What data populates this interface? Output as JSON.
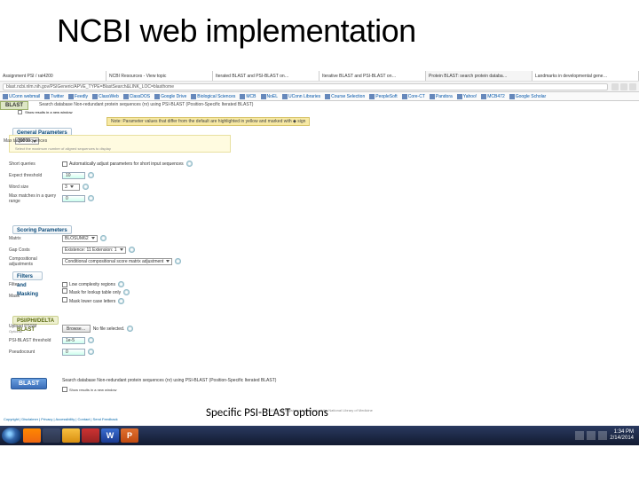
{
  "slide_title": "NCBI web implementation",
  "annotation": "Specific PSI-BLAST options",
  "tabs": [
    {
      "label": "Assignment PSI / rat4200"
    },
    {
      "label": "NCBI Resources - View topic"
    },
    {
      "label": "Iterated BLAST and PSI-BLAST on…"
    },
    {
      "label": "Iterative BLAST and PSI-BLAST on…"
    },
    {
      "label": "Protein BLAST: search protein databa…"
    },
    {
      "label": "Landmarks in developmental gene…"
    }
  ],
  "url": "blast.ncbi.nlm.nih.gov/PSIGeneric/APVE_TYPE=BlastSearch&LINK_LOC=blasthome",
  "bookmarks": [
    "UConn webmail",
    "Twitter",
    "Feedly",
    "ClassWeb",
    "ClassDOS",
    "Google Drive",
    "Biological Sciences",
    "MCB",
    "NoEL",
    "UConn Libraries",
    "Course Selection",
    "PeopleSoft",
    "Core-CT",
    "Pandora",
    "Yahoo!",
    "MCB472",
    "Google Scholar"
  ],
  "blast": {
    "title": "BLAST",
    "desc": "Search database Non-redundant protein sequences (nr) using PSI-BLAST (Position-Specific Iterated BLAST)",
    "show_new": "Show results in a new window"
  },
  "warning": "Note: Parameter values that differ from the default are highlighted in yellow and marked with ◆ sign",
  "sections": {
    "general": "General Parameters",
    "scoring": "Scoring Parameters",
    "filter": "Filters and Masking",
    "psi": "PSI/PHI/DELTA BLAST"
  },
  "general": {
    "max_target_label": "Max target sequences",
    "max_target_value": "20000",
    "max_target_hint": "Select the maximum number of aligned sequences to display",
    "short_label": "Short queries",
    "short_text": "Automatically adjust parameters for short input sequences",
    "expect_label": "Expect threshold",
    "expect_value": "10",
    "word_label": "Word size",
    "word_value": "3",
    "maxmatch_label": "Max matches in a query range",
    "maxmatch_value": "0"
  },
  "scoring": {
    "matrix_label": "Matrix",
    "matrix_value": "BLOSUM62",
    "gap_label": "Gap Costs",
    "gap_value": "Existence: 11 Extension: 1",
    "comp_label": "Compositional adjustments",
    "comp_value": "Conditional compositional score matrix adjustment"
  },
  "filter": {
    "filter_label": "Filter",
    "low_text": "Low complexity regions",
    "mask_label": "Mask",
    "mask_lookup": "Mask for lookup table only",
    "mask_lower": "Mask lower case letters"
  },
  "psi": {
    "upload_label": "Upload PSSM",
    "upload_opt": "Optional",
    "browse": "Browse…",
    "nofile": "No file selected.",
    "thresh_label": "PSI-BLAST threshold",
    "thresh_value": "1e-5",
    "pseudo_label": "Pseudocount",
    "pseudo_value": "0"
  },
  "run": {
    "button": "BLAST",
    "desc": "Search database Non-redundant protein sequences (nr) using PSI-BLAST (Position-Specific Iterated BLAST)",
    "show_new": "Show results in a new window"
  },
  "footer_text": "BLAST is a registered trademark of the National Library of Medicine",
  "footer_links": "Copyright | Disclaimer | Privacy | Accessibility | Contact | Send Feedback",
  "taskbar": {
    "time": "1:34 PM",
    "date": "2/14/2014"
  }
}
